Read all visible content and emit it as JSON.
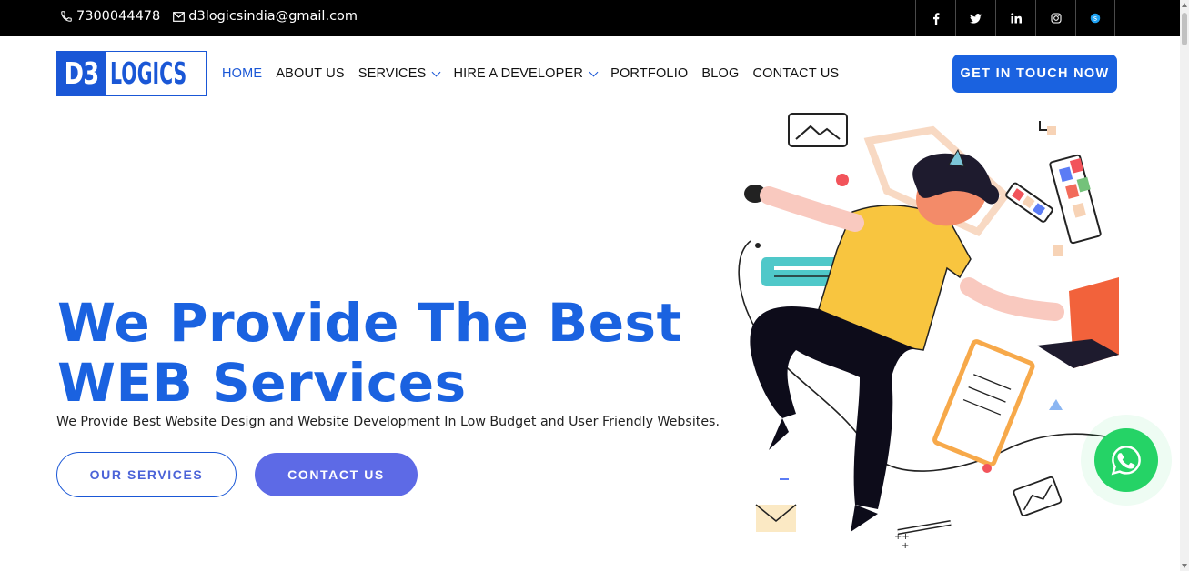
{
  "topbar": {
    "phone": "7300044478",
    "email": "d3logicsindia@gmail.com",
    "socials": [
      {
        "icon": "facebook-icon",
        "glyph": "f"
      },
      {
        "icon": "twitter-icon",
        "glyph": "t"
      },
      {
        "icon": "linkedin-icon",
        "glyph": "in"
      },
      {
        "icon": "instagram-icon",
        "glyph": "ig"
      },
      {
        "icon": "skype-icon",
        "glyph": "s"
      }
    ]
  },
  "logo": {
    "part1": "D3",
    "part2": "LOGICS"
  },
  "nav": {
    "home": "HOME",
    "about": "ABOUT US",
    "services": "SERVICES",
    "hire": "HIRE A DEVELOPER",
    "portfolio": "PORTFOLIO",
    "blog": "BLOG",
    "contact": "CONTACT US"
  },
  "header_cta": "GET IN TOUCH NOW",
  "hero": {
    "title_line1": "We Provide The Best",
    "title_line2": "WEB Services",
    "subtitle": "We Provide Best Website Design and Website Development In Low Budget and User Friendly Websites.",
    "btn_services": "OUR SERVICES",
    "btn_contact": "CONTACT US"
  },
  "colors": {
    "brand_blue": "#1a62e0",
    "button_purple": "#5d6ae6",
    "whatsapp_green": "#25d366"
  }
}
